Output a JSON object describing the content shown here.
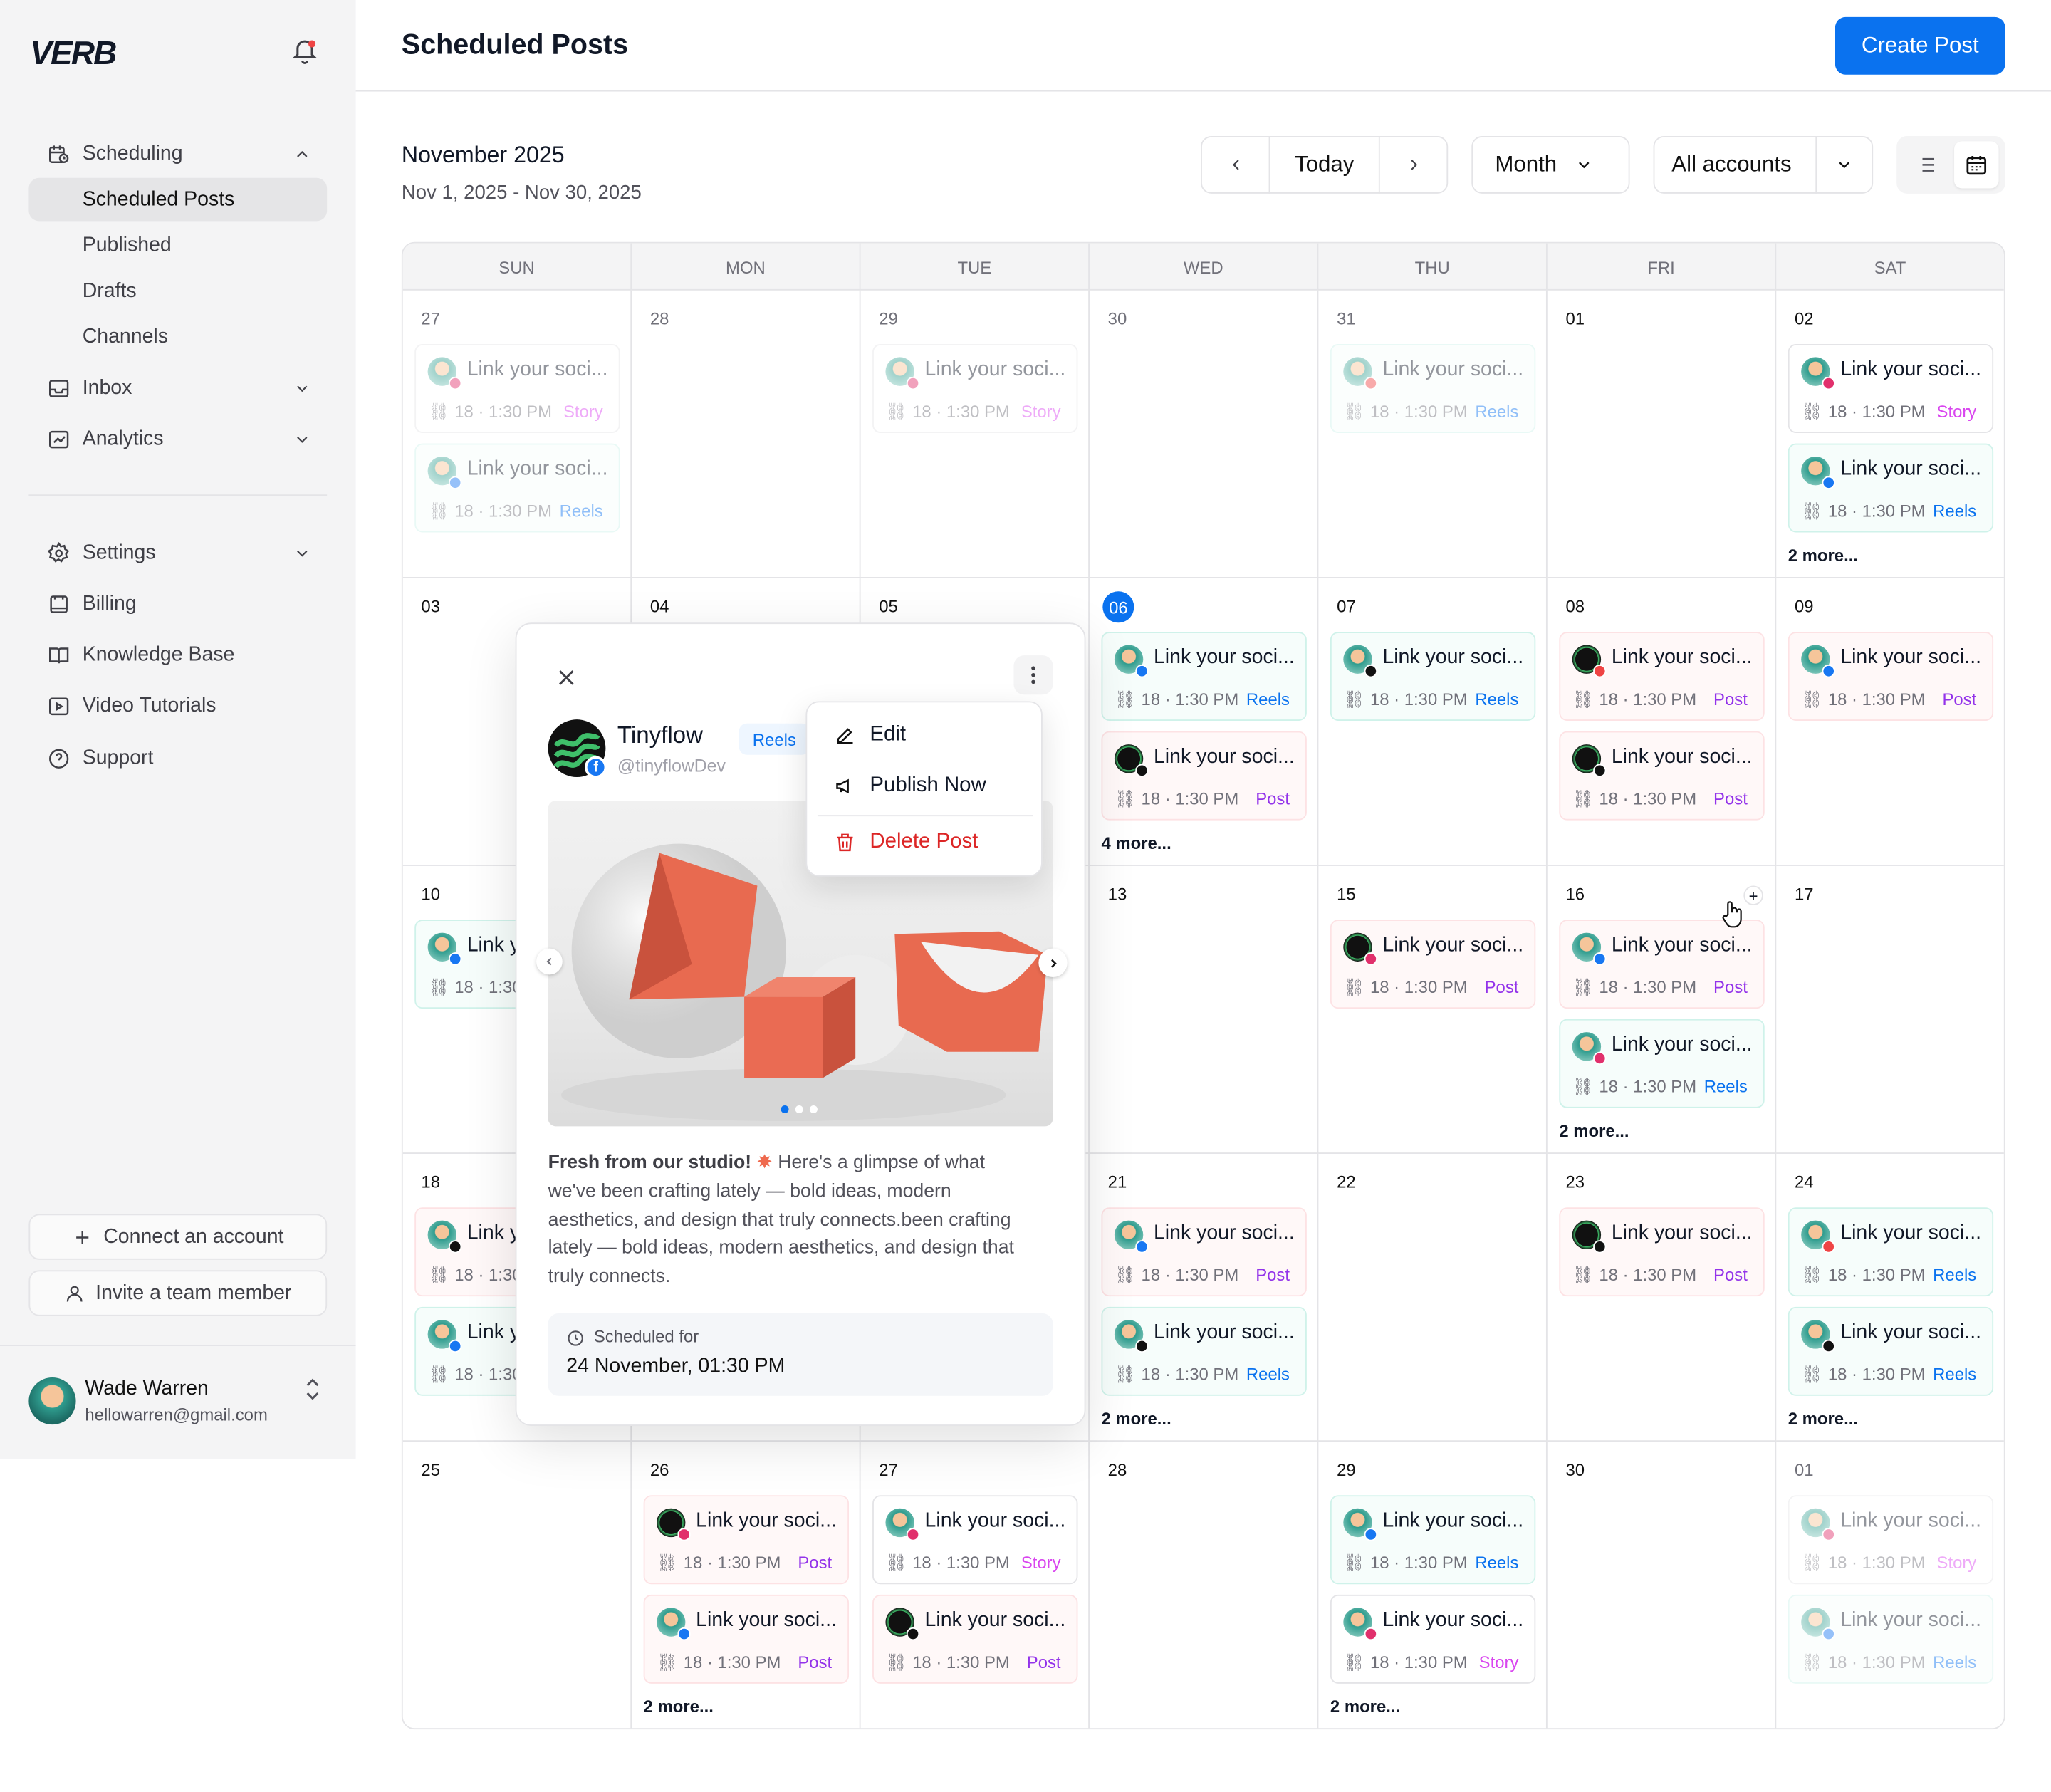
{
  "sidebar": {
    "logo": "VERB",
    "items": [
      {
        "label": "Scheduling",
        "icon": "calendar-clock-icon"
      },
      {
        "label": "Scheduled Posts"
      },
      {
        "label": "Published"
      },
      {
        "label": "Drafts"
      },
      {
        "label": "Channels"
      },
      {
        "label": "Inbox",
        "icon": "inbox-icon"
      },
      {
        "label": "Analytics",
        "icon": "chart-icon"
      },
      {
        "label": "Settings",
        "icon": "gear-icon"
      },
      {
        "label": "Billing",
        "icon": "billing-icon"
      },
      {
        "label": "Knowledge Base",
        "icon": "book-icon"
      },
      {
        "label": "Video Tutorials",
        "icon": "video-icon"
      },
      {
        "label": "Support",
        "icon": "help-icon"
      }
    ],
    "connect_label": "Connect an account",
    "invite_label": "Invite a team member",
    "user": {
      "name": "Wade Warren",
      "email": "hellowarren@gmail.com"
    }
  },
  "header": {
    "title": "Scheduled Posts",
    "create_label": "Create Post"
  },
  "toolbar": {
    "month_title": "November 2025",
    "range": "Nov 1, 2025 - Nov 30, 2025",
    "today_label": "Today",
    "view_label": "Month",
    "accounts_label": "All accounts"
  },
  "calendar": {
    "days": [
      "SUN",
      "MON",
      "TUE",
      "WED",
      "THU",
      "FRI",
      "SAT"
    ],
    "post_title": "Link your soci...",
    "post_meta": "18 · 1:30 PM",
    "truncated_title": "Link y",
    "truncated_meta": "18 · 1:30",
    "dates": [
      [
        "27",
        "28",
        "29",
        "30",
        "31",
        "01",
        "02"
      ],
      [
        "03",
        "04",
        "05",
        "06",
        "07",
        "08",
        "09"
      ],
      [
        "10",
        "",
        "",
        "13",
        "15",
        "16",
        "17"
      ],
      [
        "18",
        "",
        "",
        "21",
        "22",
        "23",
        "24"
      ],
      [
        "25",
        "26",
        "27",
        "28",
        "29",
        "30",
        "01"
      ]
    ],
    "type_labels": {
      "post": "Post",
      "reels": "Reels",
      "story": "Story"
    },
    "more": {
      "two": "2 more...",
      "four": "4 more..."
    }
  },
  "popup": {
    "account_name": "Tinyflow",
    "handle": "@tinyflowDev",
    "type": "Reels",
    "body_bold": "Fresh from our studio!",
    "body": "Here's a glimpse of what we've been crafting lately — bold ideas, modern aesthetics, and design that truly connects.been crafting lately — bold ideas, modern aesthetics, and design that truly connects.",
    "scheduled_label": "Scheduled for",
    "scheduled_value": "24 November, 01:30 PM",
    "menu": {
      "edit": "Edit",
      "publish": "Publish Now",
      "delete": "Delete Post"
    }
  },
  "colors": {
    "accent": "#0a72ef",
    "danger": "#dc2626",
    "post": "#9333ea",
    "story": "#d946ef"
  }
}
